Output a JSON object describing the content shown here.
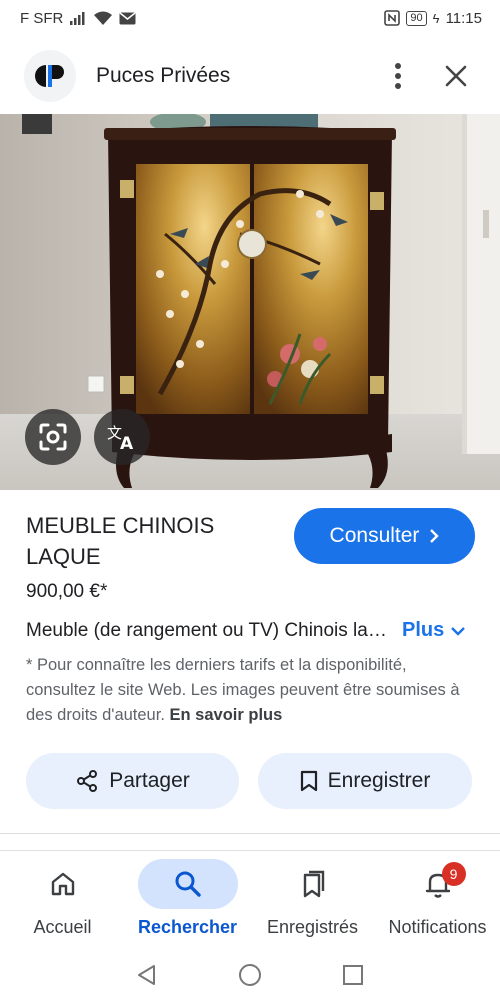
{
  "status_bar": {
    "carrier": "F SFR",
    "battery": "90",
    "time": "11:15"
  },
  "header": {
    "site_name": "Puces Privées",
    "icons": [
      "site-logo-icon",
      "more-vert-icon",
      "close-icon"
    ]
  },
  "image_overlay": {
    "icons": [
      "lens-icon",
      "translate-icon"
    ]
  },
  "product": {
    "title": "MEUBLE CHINOIS LAQUE",
    "consult_label": "Consulter",
    "price": "900,00 €*",
    "description": "Meuble (de rangement ou TV) Chinois laqué",
    "more_label": "Plus",
    "note_text": "* Pour connaître les derniers tarifs et la disponibilité, consultez le site Web. Les images peuvent être soumises à des droits d'auteur.",
    "note_link": "En savoir plus",
    "share_label": "Partager",
    "save_label": "Enregistrer"
  },
  "bottom_nav": {
    "items": [
      {
        "label": "Accueil",
        "icon": "home-icon"
      },
      {
        "label": "Rechercher",
        "icon": "search-icon"
      },
      {
        "label": "Enregistrés",
        "icon": "saved-icon"
      },
      {
        "label": "Notifications",
        "icon": "bell-icon",
        "badge": "9"
      }
    ],
    "active": "Rechercher"
  },
  "colors": {
    "accent": "#1a73e8",
    "pill_bg": "#e8f0fe",
    "nav_active_bg": "#d3e3fd",
    "badge": "#d93025"
  }
}
